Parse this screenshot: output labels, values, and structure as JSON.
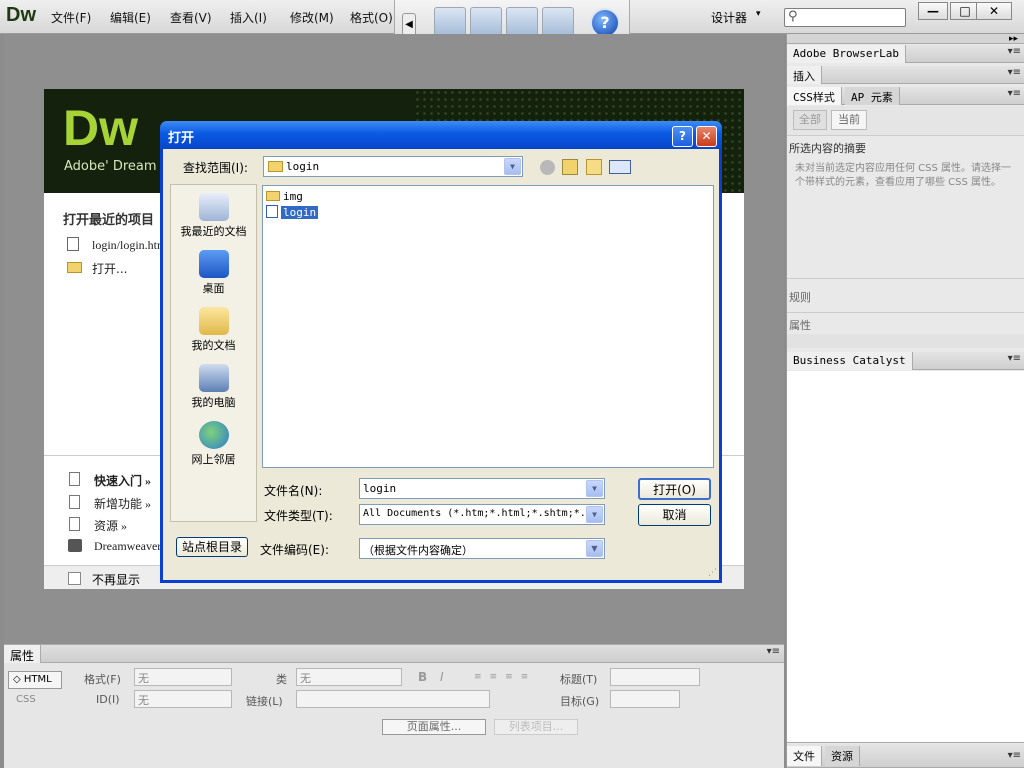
{
  "app": {
    "logo": "Dw"
  },
  "menubar": {
    "items": [
      "文件(F)",
      "编辑(E)",
      "查看(V)",
      "插入(I)",
      "修改(M)",
      "格式(O)"
    ],
    "designer": "设计器",
    "designer_caret": "▾",
    "search_icon": "⚲",
    "win_min": "—",
    "win_max": "□",
    "win_close": "✕"
  },
  "welcome": {
    "logo_big": "Dw",
    "brand": "Adobe' Dream",
    "recent_title": "打开最近的项目",
    "recent_items": [
      "login/login.htm",
      "打开..."
    ],
    "links": [
      "快速入门 »",
      "新增功能 »",
      "资源 »",
      "Dreamweaver"
    ],
    "dont_show": "不再显示"
  },
  "panels": {
    "browserlab": "Adobe BrowserLab",
    "insert": "插入",
    "css_tab": "CSS样式",
    "ap_tab": "AP 元素",
    "all_btn": "全部",
    "current_btn": "当前",
    "summary_title": "所选内容的摘要",
    "summary_text": "未对当前选定内容应用任何 CSS 属性。请选择一个带样式的元素，查看应用了哪些 CSS 属性。",
    "about": "规则",
    "properties": "属性",
    "business_catalyst": "Business Catalyst",
    "files_tab": "文件",
    "assets_tab": "资源",
    "menu_icon": "▾≡"
  },
  "properties": {
    "title": "属性",
    "html_btn": "HTML",
    "css_btn": "CSS",
    "format_label": "格式(F)",
    "format_value": "无",
    "class_label": "类",
    "class_value": "无",
    "id_label": "ID(I)",
    "id_value": "无",
    "link_label": "链接(L)",
    "title_label": "标题(T)",
    "target_label": "目标(G)",
    "bold": "B",
    "italic": "I",
    "page_props": "页面属性...",
    "list_item": "列表项目..."
  },
  "dialog": {
    "title": "打开",
    "help": "?",
    "close": "✕",
    "lookin_label": "查找范围(I):",
    "lookin_value": "login",
    "places": [
      "我最近的文档",
      "桌面",
      "我的文档",
      "我的电脑",
      "网上邻居"
    ],
    "files": [
      {
        "name": "img",
        "type": "folder"
      },
      {
        "name": "login",
        "type": "html",
        "selected": true
      }
    ],
    "filename_label": "文件名(N):",
    "filename_value": "login",
    "filetype_label": "文件类型(T):",
    "filetype_value": "All Documents (*.htm;*.html;*.shtm;*.",
    "encoding_label": "文件编码(E):",
    "encoding_value": "（根据文件内容确定）",
    "site_root_btn": "站点根目录",
    "open_btn": "打开(O)",
    "cancel_btn": "取消",
    "combo_arrow": "▼",
    "back_icon": "◀"
  },
  "colors": {
    "dialog_blue": "#0a3fd1",
    "dw_green": "#a6d437",
    "selection": "#316ac5"
  }
}
